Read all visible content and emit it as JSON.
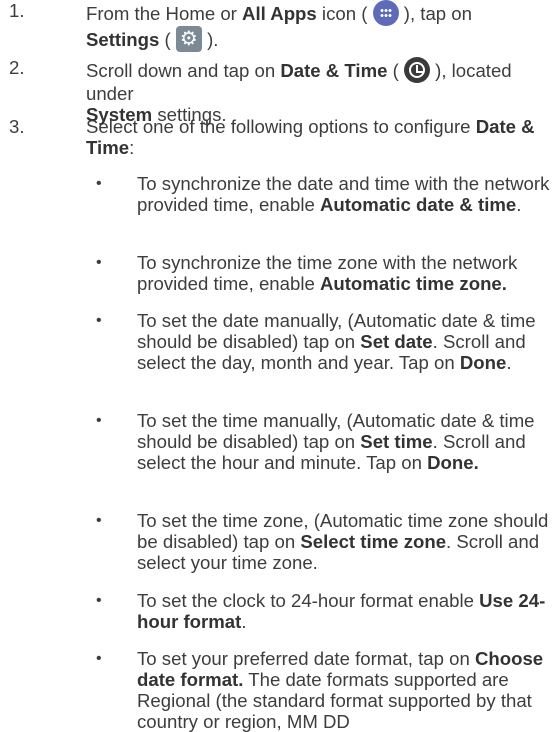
{
  "steps": [
    {
      "num": "1.",
      "parts": [
        "From the Home or ",
        "All Apps",
        " icon (",
        "), tap on ",
        "Settings",
        " (",
        ")."
      ]
    },
    {
      "num": "2.",
      "parts": [
        "Scroll down and tap on ",
        "Date & Time",
        " (",
        "), located under ",
        "System",
        " settings."
      ]
    },
    {
      "num": "3.",
      "parts": [
        "Select one of the following options to configure ",
        "Date & Time",
        ":"
      ]
    }
  ],
  "bullet_char": "•",
  "bullets": [
    [
      "To synchronize the date and time with the network provided time, enable ",
      "Automatic date & time",
      "."
    ],
    [
      "To synchronize the time zone with the network provided time, enable ",
      "Automatic time zone."
    ],
    [
      "To set the date manually, (Automatic date & time should be disabled) tap on ",
      "Set date",
      ". Scroll and select the day, month and year. Tap on ",
      "Done",
      "."
    ],
    [
      "To set the time manually, (Automatic date & time should be disabled) tap on ",
      "Set time",
      ". Scroll and select the hour and minute. Tap on ",
      "Done."
    ],
    [
      "To set the time zone, (Automatic time zone should be disabled) tap on ",
      "Select time zone",
      ". Scroll and select your time zone."
    ],
    [
      "To set the clock to 24-hour format enable ",
      "Use 24-hour format",
      "."
    ],
    [
      "To set your preferred date format, tap on ",
      "Choose date format.",
      " The date formats supported are Regional (the standard format supported by that country or region, MM DD"
    ]
  ],
  "icons": {
    "apps": "all-apps-icon",
    "settings": "settings-gear-icon",
    "clock": "clock-icon"
  }
}
